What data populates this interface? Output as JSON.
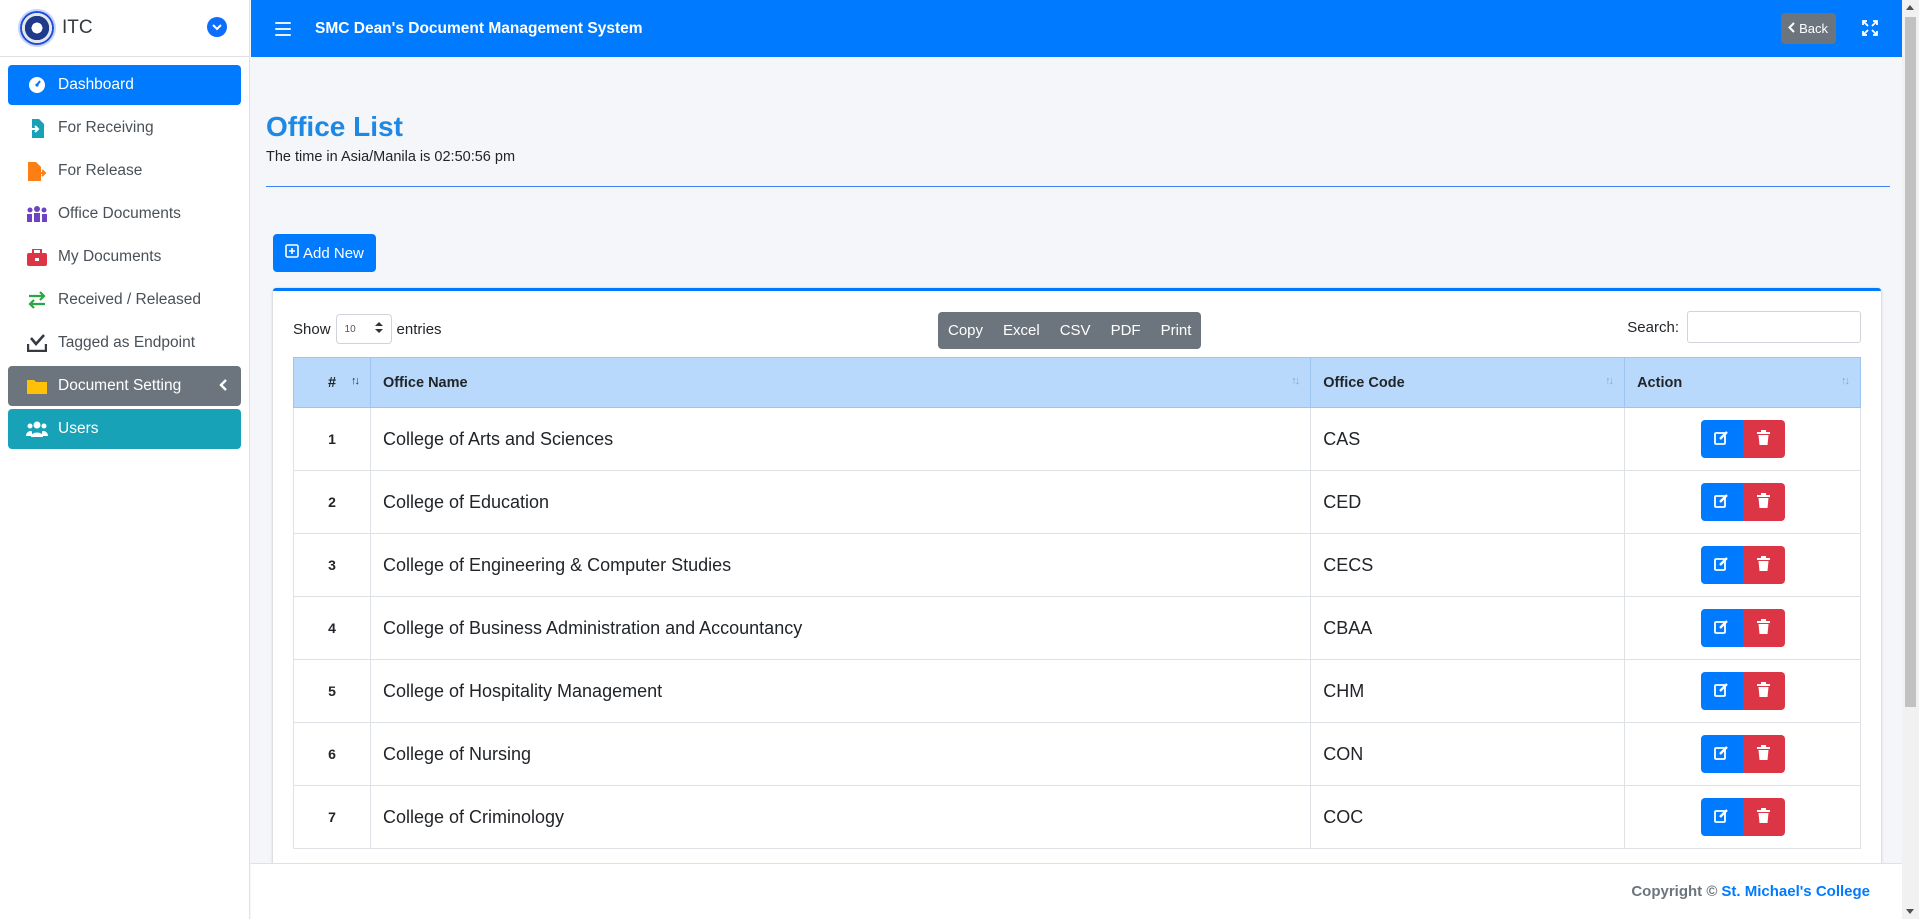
{
  "brand": {
    "name": "ITC"
  },
  "sidebar": {
    "items": [
      {
        "label": "Dashboard",
        "icon": "tachometer-icon",
        "state": "active"
      },
      {
        "label": "For Receiving",
        "icon": "file-import-icon",
        "state": "normal",
        "color": "#17a2b8"
      },
      {
        "label": "For Release",
        "icon": "file-export-icon",
        "state": "normal",
        "color": "#fd7e14"
      },
      {
        "label": "Office Documents",
        "icon": "people-group-icon",
        "state": "normal",
        "color": "#6f42c1"
      },
      {
        "label": "My Documents",
        "icon": "briefcase-icon",
        "state": "normal",
        "color": "#dc3545"
      },
      {
        "label": "Received / Released",
        "icon": "exchange-icon",
        "state": "normal",
        "color": "#28a745"
      },
      {
        "label": "Tagged as Endpoint",
        "icon": "inbox-check-icon",
        "state": "normal",
        "color": "#343a40"
      },
      {
        "label": "Document Setting",
        "icon": "folder-icon",
        "state": "secondary"
      },
      {
        "label": "Users",
        "icon": "users-icon",
        "state": "info"
      }
    ]
  },
  "topbar": {
    "title": "SMC Dean's Document Management System",
    "back_label": "Back"
  },
  "page": {
    "title": "Office List",
    "subtitle": "The time in Asia/Manila is 02:50:56 pm",
    "add_label": "Add New"
  },
  "table_controls": {
    "show_label": "Show",
    "entries_value": "10",
    "entries_label": "entries",
    "export_buttons": [
      "Copy",
      "Excel",
      "CSV",
      "PDF",
      "Print"
    ],
    "search_label": "Search:",
    "search_value": ""
  },
  "table": {
    "headers": [
      "#",
      "Office Name",
      "Office Code",
      "Action"
    ],
    "rows": [
      {
        "num": "1",
        "name": "College of Arts and Sciences",
        "code": "CAS"
      },
      {
        "num": "2",
        "name": "College of Education",
        "code": "CED"
      },
      {
        "num": "3",
        "name": "College of Engineering & Computer Studies",
        "code": "CECS"
      },
      {
        "num": "4",
        "name": "College of Business Administration and Accountancy",
        "code": "CBAA"
      },
      {
        "num": "5",
        "name": "College of Hospitality Management",
        "code": "CHM"
      },
      {
        "num": "6",
        "name": "College of Nursing",
        "code": "CON"
      },
      {
        "num": "7",
        "name": "College of Criminology",
        "code": "COC"
      }
    ]
  },
  "footer": {
    "copyright": "Copyright ©",
    "college": "St. Michael's College"
  },
  "colors": {
    "primary": "#007bff",
    "danger": "#dc3545",
    "secondary": "#6c757d",
    "info": "#17a2b8",
    "title": "#1e88e5",
    "table_header": "#b8d9fb"
  }
}
